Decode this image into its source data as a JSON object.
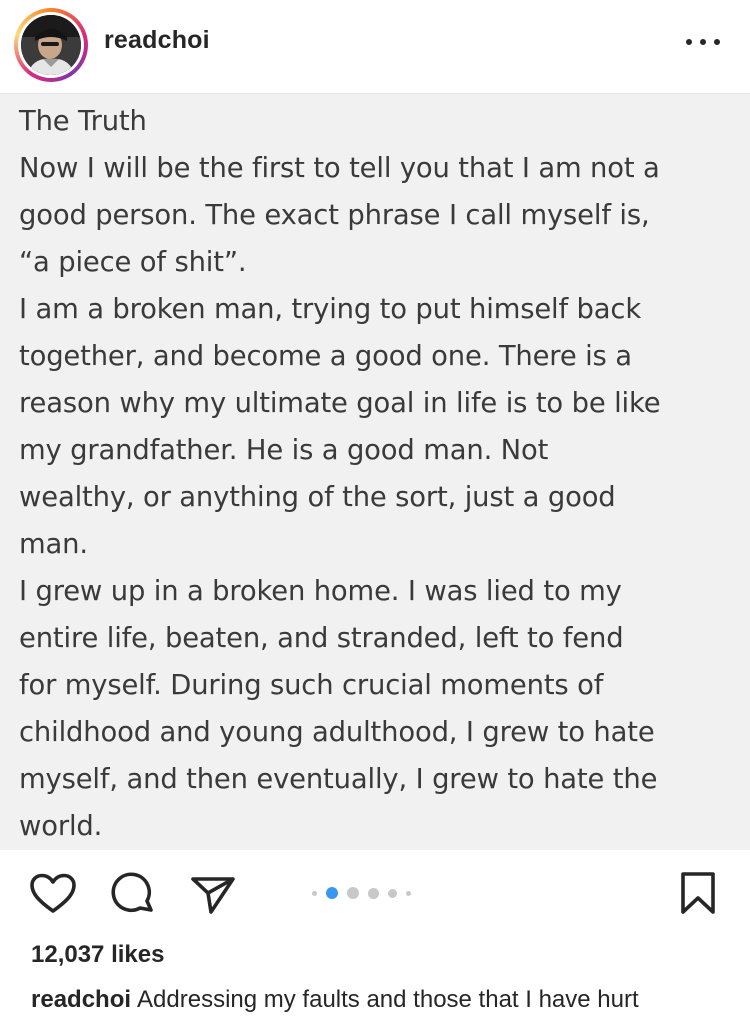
{
  "post": {
    "username": "readchoi",
    "more_label": "More options",
    "text_lines": [
      "The Truth",
      "Now I will be the first to tell you that I am not a",
      "good person. The exact phrase I call myself is,",
      "“a piece of shit”.",
      "I am a broken man, trying to put himself back",
      "together, and become a good one. There is a",
      "reason why my ultimate goal in life is to be like",
      "my grandfather. He is a good man. Not",
      "wealthy, or anything of the sort, just a good",
      "man.",
      "I grew up in a broken home. I was lied to my",
      "entire life, beaten, and stranded, left to fend",
      "for myself. During such crucial moments of",
      "childhood and young adulthood, I grew to hate",
      "myself, and then eventually, I grew to hate the",
      "world."
    ],
    "carousel": {
      "total_dots": 6,
      "active_index": 1
    },
    "likes": "12,037 likes",
    "caption": {
      "username": "readchoi",
      "text": "Addressing my faults and those that I have hurt"
    }
  },
  "icons": {
    "like": "heart-icon",
    "comment": "comment-icon",
    "share": "send-icon",
    "save": "bookmark-icon",
    "more": "more-horizontal-icon"
  },
  "colors": {
    "text": "#262626",
    "post_background": "#f1f1f1",
    "carousel_active": "#3897f0",
    "carousel_inactive": "#c8c8c8"
  }
}
